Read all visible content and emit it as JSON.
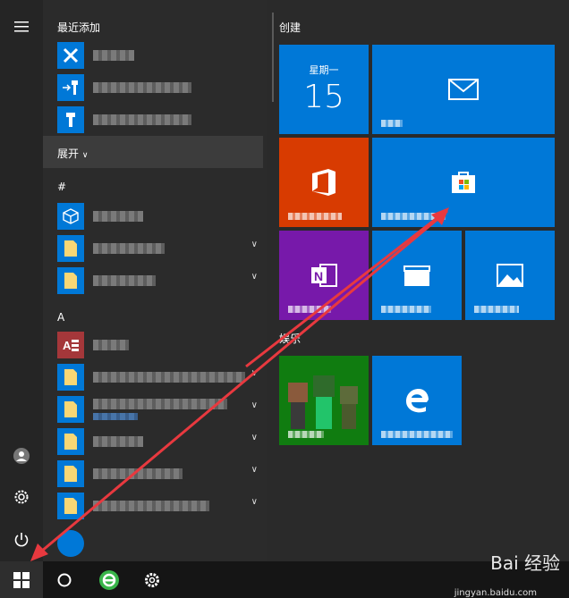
{
  "applist": {
    "recent_header": "最近添加",
    "expand_label": "展开",
    "hash_header": "#",
    "a_header": "A"
  },
  "tiles": {
    "create_header": "创建",
    "entertainment_header": "娱乐",
    "calendar": {
      "weekday": "星期一",
      "day": "15"
    }
  },
  "watermark": {
    "text": "Bai 经验",
    "sub": "jingyan.baidu.com"
  },
  "colors": {
    "accent": "#0078d7",
    "office": "#d83b01",
    "onenote": "#7719aa",
    "xbox": "#107c10",
    "arrow": "#e8393f"
  },
  "icons": [
    "hamburger-icon",
    "user-icon",
    "settings-icon",
    "power-icon",
    "windows-icon",
    "search-circle-icon",
    "browser-icon",
    "gear-icon",
    "mail-icon",
    "office-icon",
    "store-icon",
    "onenote-icon",
    "movies-icon",
    "photos-icon",
    "edge-icon"
  ]
}
